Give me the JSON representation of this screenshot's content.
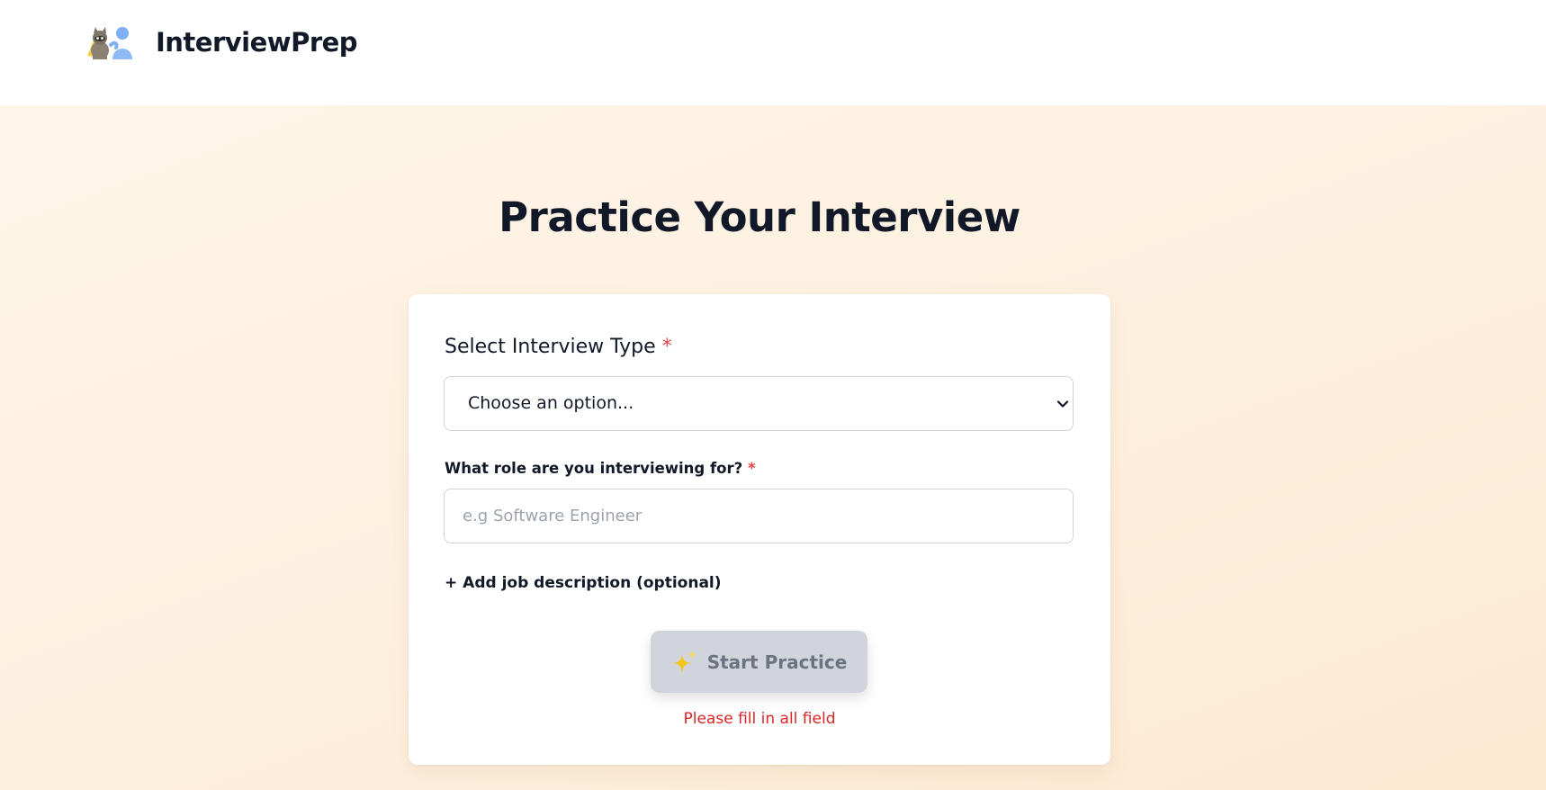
{
  "header": {
    "brand": "InterviewPrep",
    "logo_icon": "interview-mascots-icon"
  },
  "main": {
    "title": "Practice Your Interview"
  },
  "form": {
    "interview_type": {
      "label": "Select Interview Type",
      "required_mark": "*",
      "selected_value": "Choose an option...",
      "icon": "chevron-down-icon"
    },
    "role": {
      "label": "What role are you interviewing for?",
      "required_mark": "*",
      "value": "",
      "placeholder": "e.g Software Engineer"
    },
    "add_job_description": "+ Add job description (optional)",
    "start_button": {
      "label": "Start Practice",
      "icon": "sparkle-icon",
      "disabled": true
    },
    "error": "Please fill in all field"
  },
  "colors": {
    "background": "#fdf0df",
    "card": "#ffffff",
    "required": "#ef4444",
    "error": "#dc2626",
    "button_disabled": "#d1d5db",
    "button_text": "#6b7280",
    "text": "#111827"
  }
}
